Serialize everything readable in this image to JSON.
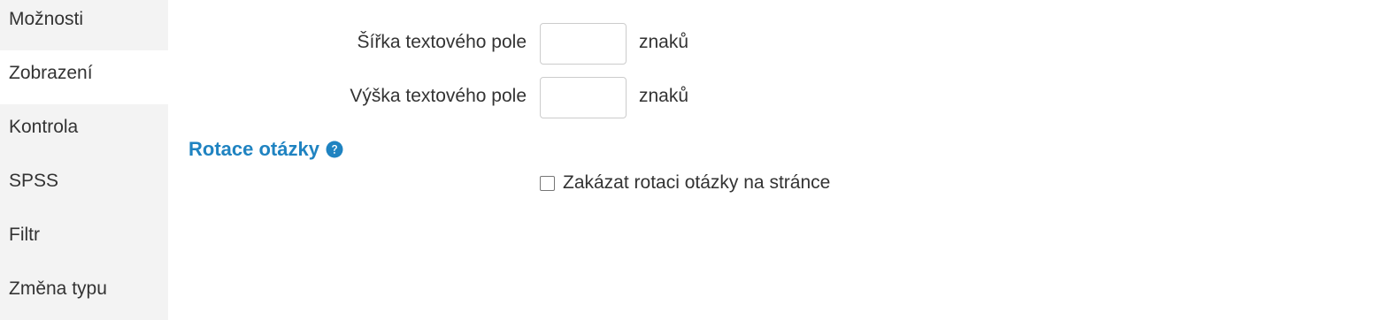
{
  "sidebar": {
    "items": [
      {
        "label": "Možnosti",
        "active": false
      },
      {
        "label": "Zobrazení",
        "active": true
      },
      {
        "label": "Kontrola",
        "active": false
      },
      {
        "label": "SPSS",
        "active": false
      },
      {
        "label": "Filtr",
        "active": false
      },
      {
        "label": "Změna typu",
        "active": false
      }
    ]
  },
  "form": {
    "width_label": "Šířka textového pole",
    "width_value": "",
    "width_unit": "znaků",
    "height_label": "Výška textového pole",
    "height_value": "",
    "height_unit": "znaků"
  },
  "rotation": {
    "title": "Rotace otázky",
    "help_icon": "question-circle-icon",
    "checkbox_label": "Zakázat rotaci otázky na stránce",
    "checkbox_checked": false
  },
  "colors": {
    "accent": "#1f83c1",
    "sidebar_bg": "#f3f3f3",
    "active_bg": "#ffffff",
    "text": "#333333"
  }
}
